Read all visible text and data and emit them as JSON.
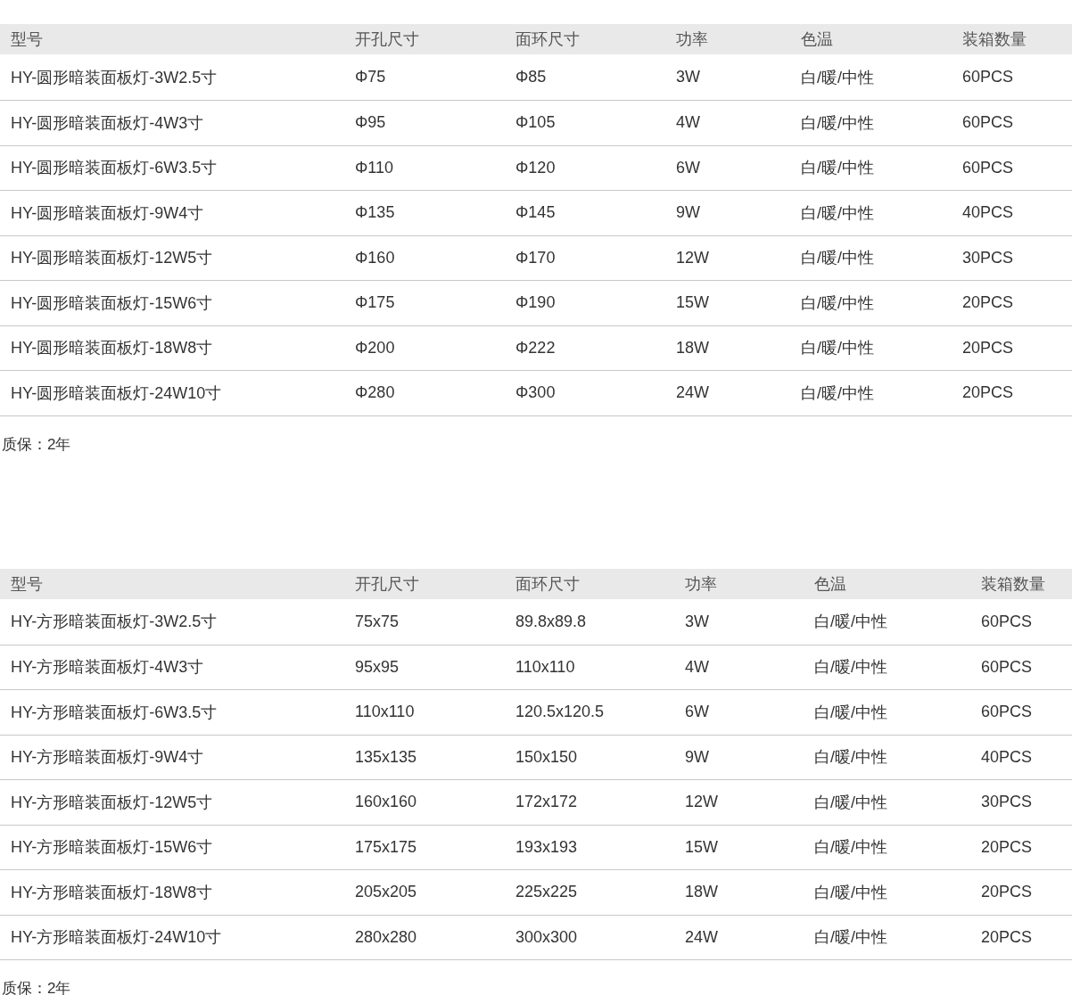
{
  "tables": [
    {
      "columns": [
        "型号",
        "开孔尺寸",
        "面环尺寸",
        "功率",
        "色温",
        "装箱数量"
      ],
      "rows": [
        [
          "HY-圆形暗装面板灯-3W2.5寸",
          "Φ75",
          "Φ85",
          "3W",
          "白/暖/中性",
          "60PCS"
        ],
        [
          "HY-圆形暗装面板灯-4W3寸",
          "Φ95",
          "Φ105",
          "4W",
          "白/暖/中性",
          "60PCS"
        ],
        [
          "HY-圆形暗装面板灯-6W3.5寸",
          "Φ110",
          "Φ120",
          "6W",
          "白/暖/中性",
          "60PCS"
        ],
        [
          "HY-圆形暗装面板灯-9W4寸",
          "Φ135",
          "Φ145",
          "9W",
          "白/暖/中性",
          "40PCS"
        ],
        [
          "HY-圆形暗装面板灯-12W5寸",
          "Φ160",
          "Φ170",
          "12W",
          "白/暖/中性",
          "30PCS"
        ],
        [
          "HY-圆形暗装面板灯-15W6寸",
          "Φ175",
          "Φ190",
          "15W",
          "白/暖/中性",
          "20PCS"
        ],
        [
          "HY-圆形暗装面板灯-18W8寸",
          "Φ200",
          "Φ222",
          "18W",
          "白/暖/中性",
          "20PCS"
        ],
        [
          "HY-圆形暗装面板灯-24W10寸",
          "Φ280",
          "Φ300",
          "24W",
          "白/暖/中性",
          "20PCS"
        ]
      ],
      "note": "质保：2年"
    },
    {
      "columns": [
        "型号",
        "开孔尺寸",
        "面环尺寸",
        "功率",
        "色温",
        "装箱数量"
      ],
      "rows": [
        [
          "HY-方形暗装面板灯-3W2.5寸",
          "75x75",
          "89.8x89.8",
          "3W",
          "白/暖/中性",
          "60PCS"
        ],
        [
          "HY-方形暗装面板灯-4W3寸",
          "95x95",
          "110x110",
          "4W",
          "白/暖/中性",
          "60PCS"
        ],
        [
          "HY-方形暗装面板灯-6W3.5寸",
          "110x110",
          "120.5x120.5",
          "6W",
          "白/暖/中性",
          "60PCS"
        ],
        [
          "HY-方形暗装面板灯-9W4寸",
          "135x135",
          "150x150",
          "9W",
          "白/暖/中性",
          "40PCS"
        ],
        [
          "HY-方形暗装面板灯-12W5寸",
          "160x160",
          "172x172",
          "12W",
          "白/暖/中性",
          "30PCS"
        ],
        [
          "HY-方形暗装面板灯-15W6寸",
          "175x175",
          "193x193",
          "15W",
          "白/暖/中性",
          "20PCS"
        ],
        [
          "HY-方形暗装面板灯-18W8寸",
          "205x205",
          "225x225",
          "18W",
          "白/暖/中性",
          "20PCS"
        ],
        [
          "HY-方形暗装面板灯-24W10寸",
          "280x280",
          "300x300",
          "24W",
          "白/暖/中性",
          "20PCS"
        ]
      ],
      "note": "质保：2年"
    }
  ]
}
